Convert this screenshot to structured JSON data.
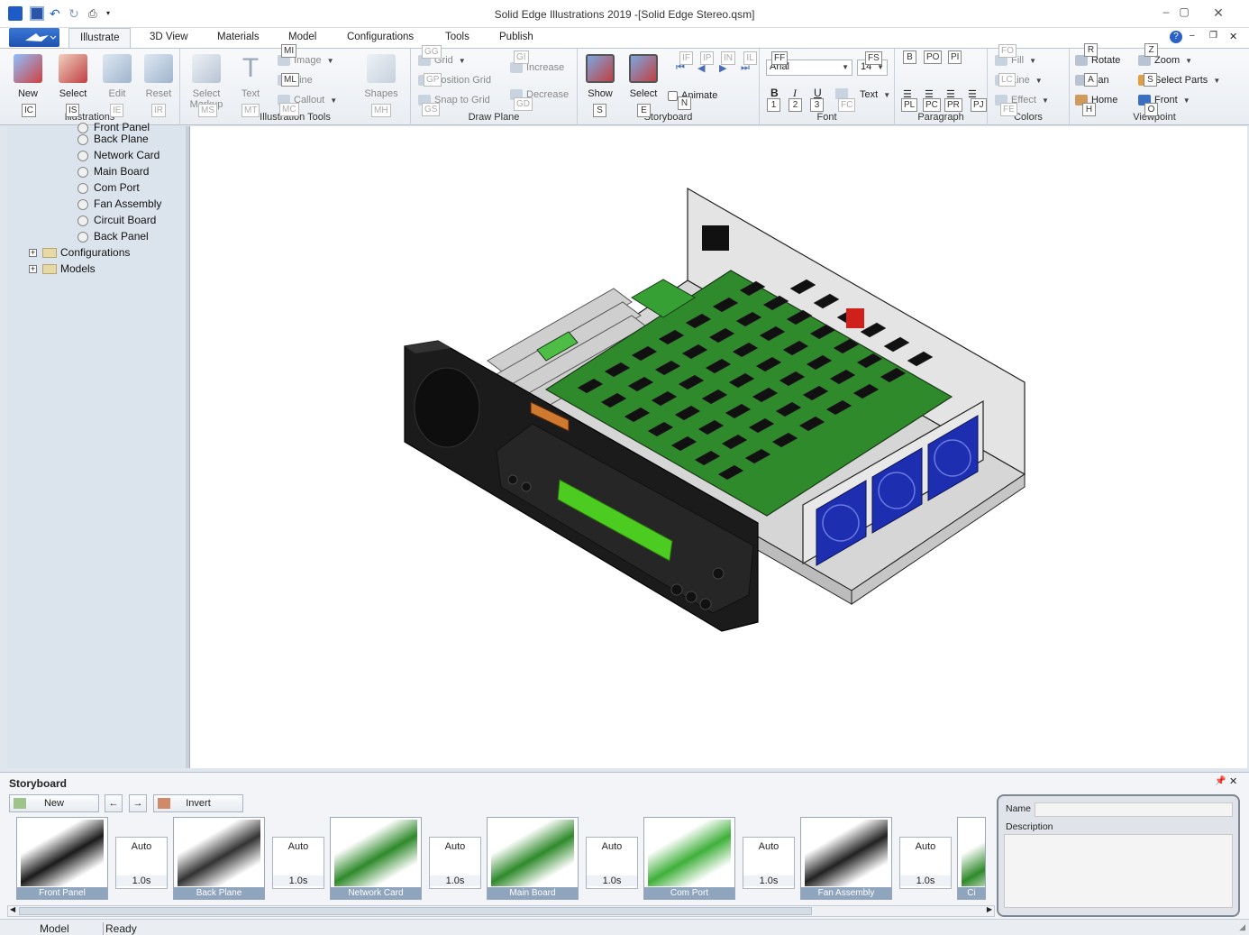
{
  "titlebar": {
    "title": "Solid Edge Illustrations  2019 -[Solid Edge Stereo.qsm]"
  },
  "tabs": [
    "Illustrate",
    "3D View",
    "Materials",
    "Model",
    "Configurations",
    "Tools",
    "Publish"
  ],
  "ribbon": {
    "illustrations": {
      "label": "Illustrations",
      "new": "New",
      "select": "Select",
      "edit": "Edit",
      "reset": "Reset"
    },
    "illustration_tools": {
      "label": "Illustration Tools",
      "select_markup": "Select Markup",
      "text": "Text",
      "image": "Image",
      "line": "Line",
      "callout": "Callout",
      "shapes": "Shapes"
    },
    "draw_plane": {
      "label": "Draw Plane",
      "grid": "Grid",
      "position_grid": "Position Grid",
      "snap_to_grid": "Snap to Grid",
      "increase": "Increase",
      "decrease": "Decrease"
    },
    "storyboard": {
      "label": "Storyboard",
      "show": "Show",
      "select": "Select",
      "animate": "Animate"
    },
    "font": {
      "label": "Font",
      "family": "Arial",
      "size": "14",
      "text": "Text"
    },
    "paragraph": {
      "label": "Paragraph"
    },
    "colors": {
      "label": "Colors",
      "fill": "Fill",
      "line": "Line",
      "effect": "Effect"
    },
    "viewpoint": {
      "label": "Viewpoint",
      "rotate": "Rotate",
      "pan": "Pan",
      "home": "Home",
      "zoom": "Zoom",
      "select_parts": "Select Parts",
      "front": "Front"
    },
    "keytips": {
      "mi": "MI",
      "ml": "ML",
      "mc": "MC",
      "ms": "MS",
      "mt": "MT",
      "mh": "MH",
      "ic": "IC",
      "is": "IS",
      "ie": "IE",
      "ir": "IR",
      "gg": "GG",
      "gp": "GP",
      "gs": "GS",
      "gi": "GI",
      "gd": "GD",
      "s": "S",
      "e": "E",
      "n": "N",
      "if": "IF",
      "ip": "IP",
      "in": "IN",
      "il": "IL",
      "ff": "FF",
      "fs": "FS",
      "fc": "FC",
      "b1": "1",
      "b2": "2",
      "b3": "3",
      "b": "B",
      "po": "PO",
      "pi": "PI",
      "pl": "PL",
      "pc": "PC",
      "pr": "PR",
      "pj": "PJ",
      "fo": "FO",
      "lc": "LC",
      "fe": "FE",
      "r": "R",
      "a": "A",
      "h": "H",
      "z": "Z",
      "sp": "S",
      "o": "O"
    }
  },
  "tree": {
    "items": [
      "Front Panel",
      "Back Plane",
      "Network Card",
      "Main Board",
      "Com Port",
      "Fan Assembly",
      "Circuit Board",
      "Back Panel"
    ],
    "folders": [
      "Configurations",
      "Models"
    ]
  },
  "storyboard": {
    "title": "Storyboard",
    "new": "New",
    "invert": "Invert",
    "frames": [
      "Front Panel",
      "Back Plane",
      "Network Card",
      "Main Board",
      "Com Port",
      "Fan Assembly",
      "Ci"
    ],
    "transition": {
      "mode": "Auto",
      "duration": "1.0s"
    },
    "props": {
      "name_label": "Name",
      "description_label": "Description"
    }
  },
  "status": {
    "left": "Model",
    "right": "Ready"
  }
}
